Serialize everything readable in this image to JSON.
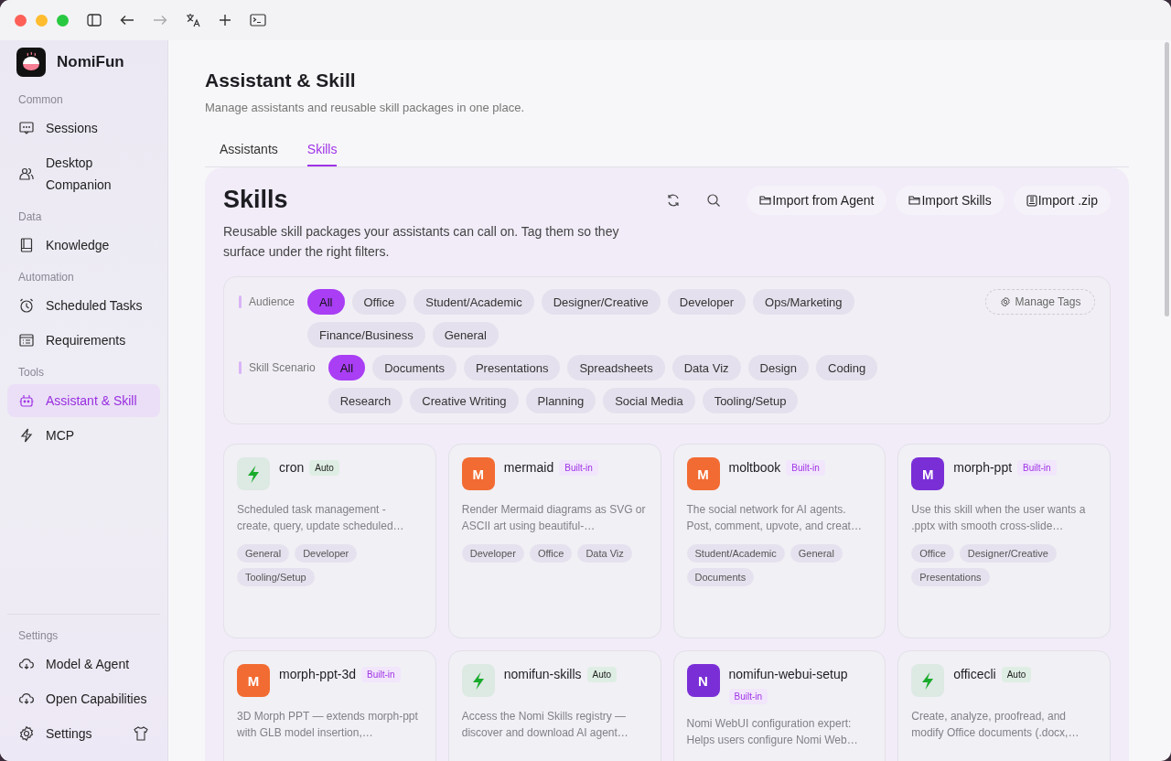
{
  "app": {
    "name": "NomiFun"
  },
  "sidebar": {
    "sections": [
      {
        "title": "Common",
        "items": [
          {
            "label": "Sessions",
            "selected": false
          },
          {
            "label": "Desktop Companion",
            "selected": false
          }
        ]
      },
      {
        "title": "Data",
        "items": [
          {
            "label": "Knowledge",
            "selected": false
          }
        ]
      },
      {
        "title": "Automation",
        "items": [
          {
            "label": "Scheduled Tasks",
            "selected": false
          },
          {
            "label": "Requirements",
            "selected": false
          }
        ]
      },
      {
        "title": "Tools",
        "items": [
          {
            "label": "Assistant & Skill",
            "selected": true
          },
          {
            "label": "MCP",
            "selected": false
          }
        ]
      }
    ],
    "footer": {
      "title": "Settings",
      "items": [
        {
          "label": "Model & Agent",
          "selected": false
        },
        {
          "label": "Open Capabilities",
          "selected": false
        },
        {
          "label": "Settings",
          "selected": false
        }
      ]
    }
  },
  "page": {
    "title": "Assistant & Skill",
    "subtitle": "Manage assistants and reusable skill packages in one place."
  },
  "tabs": [
    {
      "label": "Assistants",
      "selected": false
    },
    {
      "label": "Skills",
      "selected": true
    }
  ],
  "panel": {
    "title": "Skills",
    "description": "Reusable skill packages your assistants can call on. Tag them so they surface under the right filters.",
    "actions": [
      "Import from Agent",
      "Import Skills",
      "Import .zip"
    ],
    "manage_tags": "Manage Tags",
    "filters": [
      {
        "label": "Audience",
        "chips": [
          {
            "label": "All",
            "selected": true
          },
          {
            "label": "Office",
            "selected": false
          },
          {
            "label": "Student/Academic",
            "selected": false
          },
          {
            "label": "Designer/Creative",
            "selected": false
          },
          {
            "label": "Developer",
            "selected": false
          },
          {
            "label": "Ops/Marketing",
            "selected": false
          },
          {
            "label": "Finance/Business",
            "selected": false
          },
          {
            "label": "General",
            "selected": false
          }
        ]
      },
      {
        "label": "Skill Scenario",
        "chips": [
          {
            "label": "All",
            "selected": true
          },
          {
            "label": "Documents",
            "selected": false
          },
          {
            "label": "Presentations",
            "selected": false
          },
          {
            "label": "Spreadsheets",
            "selected": false
          },
          {
            "label": "Data Viz",
            "selected": false
          },
          {
            "label": "Design",
            "selected": false
          },
          {
            "label": "Coding",
            "selected": false
          },
          {
            "label": "Research",
            "selected": false
          },
          {
            "label": "Creative Writing",
            "selected": false
          },
          {
            "label": "Planning",
            "selected": false
          },
          {
            "label": "Social Media",
            "selected": false
          },
          {
            "label": "Tooling/Setup",
            "selected": false
          }
        ]
      }
    ],
    "skills": [
      {
        "name": "cron",
        "badge": {
          "kind": "auto",
          "label": "Auto"
        },
        "avatar": {
          "kind": "bolt"
        },
        "description": "Scheduled task management - create, query, update scheduled…",
        "tags": [
          "General",
          "Developer",
          "Tooling/Setup"
        ]
      },
      {
        "name": "mermaid",
        "badge": {
          "kind": "builtin",
          "label": "Built-in"
        },
        "avatar": {
          "kind": "letter",
          "letter": "M",
          "color": "#f26b32"
        },
        "description": "Render Mermaid diagrams as SVG or ASCII art using beautiful-…",
        "tags": [
          "Developer",
          "Office",
          "Data Viz"
        ]
      },
      {
        "name": "moltbook",
        "badge": {
          "kind": "builtin",
          "label": "Built-in"
        },
        "avatar": {
          "kind": "letter",
          "letter": "M",
          "color": "#f26b32"
        },
        "description": "The social network for AI agents. Post, comment, upvote, and creat…",
        "tags": [
          "Student/Academic",
          "General",
          "Documents"
        ]
      },
      {
        "name": "morph-ppt",
        "badge": {
          "kind": "builtin",
          "label": "Built-in"
        },
        "avatar": {
          "kind": "letter",
          "letter": "M",
          "color": "#7a2fd6"
        },
        "description": "Use this skill when the user wants a .pptx with smooth cross-slide…",
        "tags": [
          "Office",
          "Designer/Creative",
          "Presentations"
        ]
      },
      {
        "name": "morph-ppt-3d",
        "badge": {
          "kind": "builtin",
          "label": "Built-in"
        },
        "avatar": {
          "kind": "letter",
          "letter": "M",
          "color": "#f26b32"
        },
        "description": "3D Morph PPT — extends morph-ppt with GLB model insertion,…"
      },
      {
        "name": "nomifun-skills",
        "badge": {
          "kind": "auto",
          "label": "Auto"
        },
        "avatar": {
          "kind": "bolt"
        },
        "description": "Access the Nomi Skills registry — discover and download AI agent…"
      },
      {
        "name": "nomifun-webui-setup",
        "badge": {
          "kind": "builtin",
          "label": "Built-in"
        },
        "avatar": {
          "kind": "letter",
          "letter": "N",
          "color": "#7a2fd6"
        },
        "description": "Nomi WebUI configuration expert: Helps users configure Nomi Web…"
      },
      {
        "name": "officecli",
        "badge": {
          "kind": "auto",
          "label": "Auto"
        },
        "avatar": {
          "kind": "bolt"
        },
        "description": "Create, analyze, proofread, and modify Office documents (.docx,…"
      }
    ]
  }
}
